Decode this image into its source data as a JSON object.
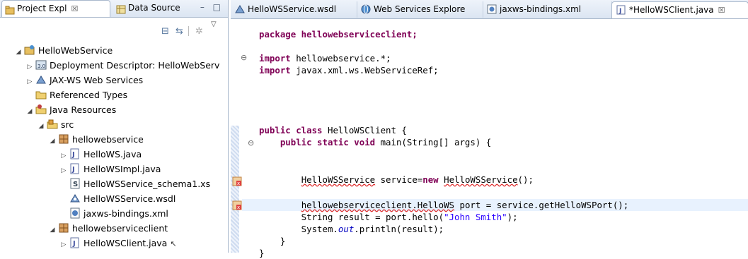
{
  "left_panel": {
    "tabs": [
      {
        "label": "Project Expl",
        "close": "☒"
      },
      {
        "label": "Data Source"
      }
    ],
    "window_controls": "– □",
    "tree": [
      {
        "label": "HelloWebService",
        "icon": "project-icon",
        "twisty": "◢"
      },
      {
        "label": "Deployment Descriptor: HelloWebServ",
        "icon": "deployment-descriptor-icon",
        "twisty": "▷"
      },
      {
        "label": "JAX-WS Web Services",
        "icon": "web-services-icon",
        "twisty": "▷"
      },
      {
        "label": "Referenced Types",
        "icon": "folder-icon",
        "twisty": ""
      },
      {
        "label": "Java Resources",
        "icon": "java-resources-icon",
        "twisty": "◢"
      },
      {
        "label": "src",
        "icon": "source-folder-icon",
        "twisty": "◢"
      },
      {
        "label": "hellowebservice",
        "icon": "package-icon",
        "twisty": "◢"
      },
      {
        "label": "HelloWS.java",
        "icon": "java-interface-icon",
        "twisty": "▷"
      },
      {
        "label": "HelloWSImpl.java",
        "icon": "java-class-icon",
        "twisty": "▷"
      },
      {
        "label": "HelloWSService_schema1.xs",
        "icon": "schema-file-icon",
        "twisty": ""
      },
      {
        "label": "HelloWSService.wsdl",
        "icon": "wsdl-file-icon",
        "twisty": ""
      },
      {
        "label": "jaxws-bindings.xml",
        "icon": "xml-file-icon",
        "twisty": ""
      },
      {
        "label": "hellowebserviceclient",
        "icon": "package-icon",
        "twisty": "◢"
      },
      {
        "label": "HelloWSClient.java",
        "icon": "java-file-icon",
        "twisty": "▷"
      }
    ]
  },
  "editor": {
    "tabs": [
      {
        "label": "HelloWSService.wsdl",
        "icon": "wsdl-file-icon"
      },
      {
        "label": "Web Services Explore",
        "icon": "globe-icon"
      },
      {
        "label": "jaxws-bindings.xml",
        "icon": "xml-file-icon"
      },
      {
        "label": "*HelloWSClient.java",
        "icon": "java-file-icon",
        "close": "☒"
      }
    ],
    "lines": {
      "l1": "package hellowebserviceclient;",
      "l3a": "import ",
      "l3b": "hellowebservice.*;",
      "l4a": "import ",
      "l4b": "javax.xml.ws.WebServiceRef;",
      "l9a": "public class ",
      "l9b": "HelloWSClient {",
      "l10a": "    public static void ",
      "l10b": "main(String[] args) {",
      "l13a": "        ",
      "l13b": "HelloWSService",
      "l13c": " service=",
      "l13d": "new ",
      "l13e": "HelloWSService",
      "l13f": "();",
      "l15a": "        ",
      "l15b": "hellowebserviceclient.HelloWS",
      "l15c": " port = service.getHelloWSPort();",
      "l16a": "        String result = port.hello(",
      "l16b": "\"John Smith\"",
      "l16c": ");",
      "l17a": "        System.",
      "l17b": "out",
      "l17c": ".println(result);",
      "l18": "    }",
      "l19": "}"
    }
  }
}
